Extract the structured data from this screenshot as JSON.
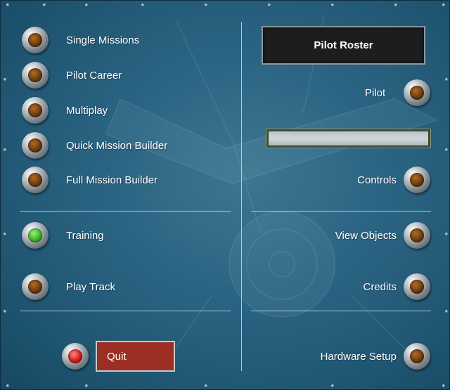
{
  "left_menu": {
    "items": [
      {
        "label": "Single Missions",
        "light": "amber"
      },
      {
        "label": "Pilot Career",
        "light": "amber"
      },
      {
        "label": "Multiplay",
        "light": "amber"
      },
      {
        "label": "Quick Mission Builder",
        "light": "amber"
      },
      {
        "label": "Full Mission Builder",
        "light": "amber"
      },
      {
        "label": "Training",
        "light": "green"
      },
      {
        "label": "Play Track",
        "light": "amber"
      }
    ],
    "quit_label": "Quit"
  },
  "right_menu": {
    "roster_title": "Pilot Roster",
    "pilot_label": "Pilot",
    "pilot_name_value": "",
    "items": [
      {
        "label": "Controls"
      },
      {
        "label": "View Objects"
      },
      {
        "label": "Credits"
      },
      {
        "label": "Hardware Setup"
      }
    ]
  },
  "colors": {
    "background": "#2b6483",
    "quit_button": "#9c2f23",
    "amber_light": "#8a4a12",
    "green_light": "#38b21e",
    "red_light": "#d01818"
  }
}
